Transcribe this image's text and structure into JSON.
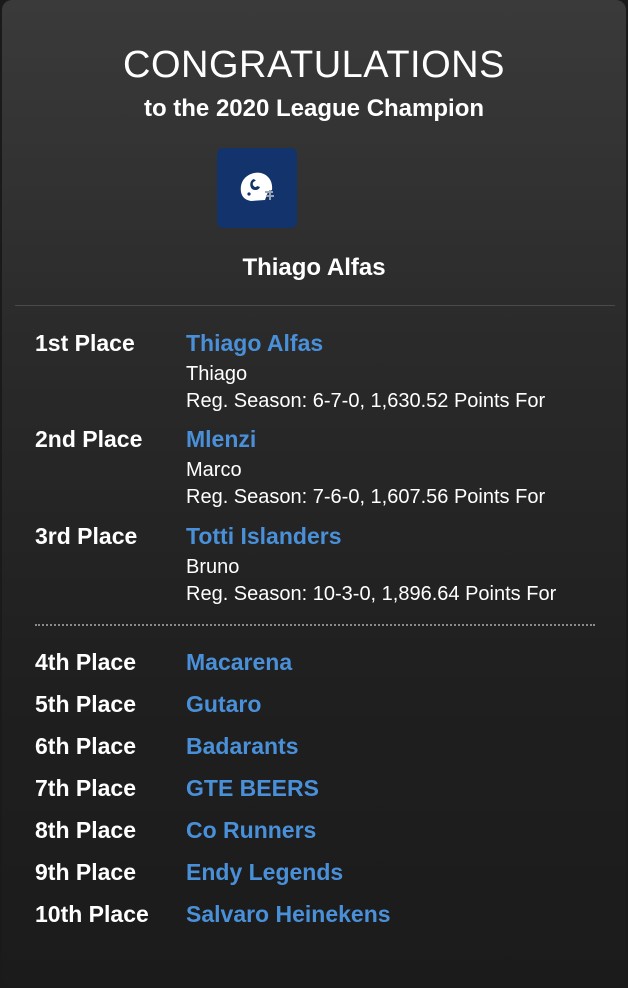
{
  "header": {
    "headline": "CONGRATULATIONS",
    "subline": "to the 2020 League Champion",
    "logo_icon": "football-helmet-icon",
    "champion_name": "Thiago Alfas",
    "colors": {
      "logo_bg": "#12336b",
      "team_link": "#4a90d9"
    }
  },
  "podium": [
    {
      "place": "1st Place",
      "team": "Thiago Alfas",
      "owner": "Thiago",
      "record": "Reg. Season: 6-7-0, 1,630.52 Points For"
    },
    {
      "place": "2nd Place",
      "team": "Mlenzi",
      "owner": "Marco",
      "record": "Reg. Season: 7-6-0, 1,607.56 Points For"
    },
    {
      "place": "3rd Place",
      "team": "Totti Islanders",
      "owner": "Bruno",
      "record": "Reg. Season: 10-3-0, 1,896.64 Points For"
    }
  ],
  "others": [
    {
      "place": "4th Place",
      "team": "Macarena"
    },
    {
      "place": "5th Place",
      "team": "Gutaro"
    },
    {
      "place": "6th Place",
      "team": "Badarants"
    },
    {
      "place": "7th Place",
      "team": "GTE BEERS"
    },
    {
      "place": "8th Place",
      "team": "Co Runners"
    },
    {
      "place": "9th Place",
      "team": "Endy Legends"
    },
    {
      "place": "10th Place",
      "team": "Salvaro Heinekens"
    }
  ]
}
